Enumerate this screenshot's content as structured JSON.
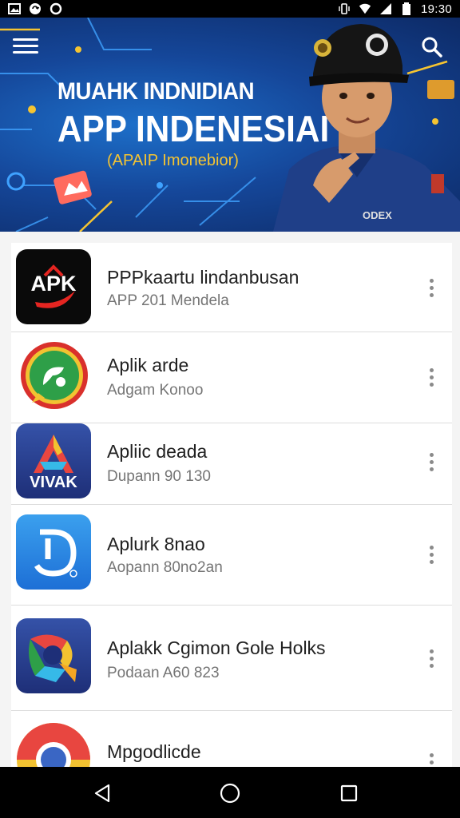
{
  "status_bar": {
    "time": "19:30",
    "left_icons": [
      "image-icon",
      "sync-icon",
      "circle-icon"
    ],
    "right_icons": [
      "vibrate-icon",
      "wifi-icon",
      "signal-icon",
      "battery-icon"
    ]
  },
  "banner": {
    "title_line1": "MUAHK INDNIDIAN",
    "title_line2": "APP  INDENESIAI",
    "subtitle": "(APAIP Imonebior)",
    "badge_text": "ODEX",
    "accent_color": "#f5c431",
    "background_color": "#15479a"
  },
  "apps": [
    {
      "name": "PPPkaartu lindanbusan",
      "subtitle": "APP 201 Mendela",
      "icon": "apk-icon",
      "icon_text": "APK"
    },
    {
      "name": "Aplik arde",
      "subtitle": "Adgam Konoo",
      "icon": "chat-bubble-icon",
      "icon_text": ""
    },
    {
      "name": "Apliic deada",
      "subtitle": "Dupann 90 130",
      "icon": "vivak-icon",
      "icon_text": "VIVAK"
    },
    {
      "name": "Aplurk 8nao",
      "subtitle": "Aopann 80no2an",
      "icon": "d-letter-icon",
      "icon_text": ""
    },
    {
      "name": "Aplakk Cgimon Gole Holks",
      "subtitle": "Podaan A60 823",
      "icon": "maps-icon",
      "icon_text": ""
    },
    {
      "name": "Mpgodlicde",
      "subtitle": "",
      "icon": "chrome-icon",
      "icon_text": ""
    }
  ],
  "nav": {
    "back": "back-icon",
    "home": "home-icon",
    "recents": "recents-icon"
  }
}
